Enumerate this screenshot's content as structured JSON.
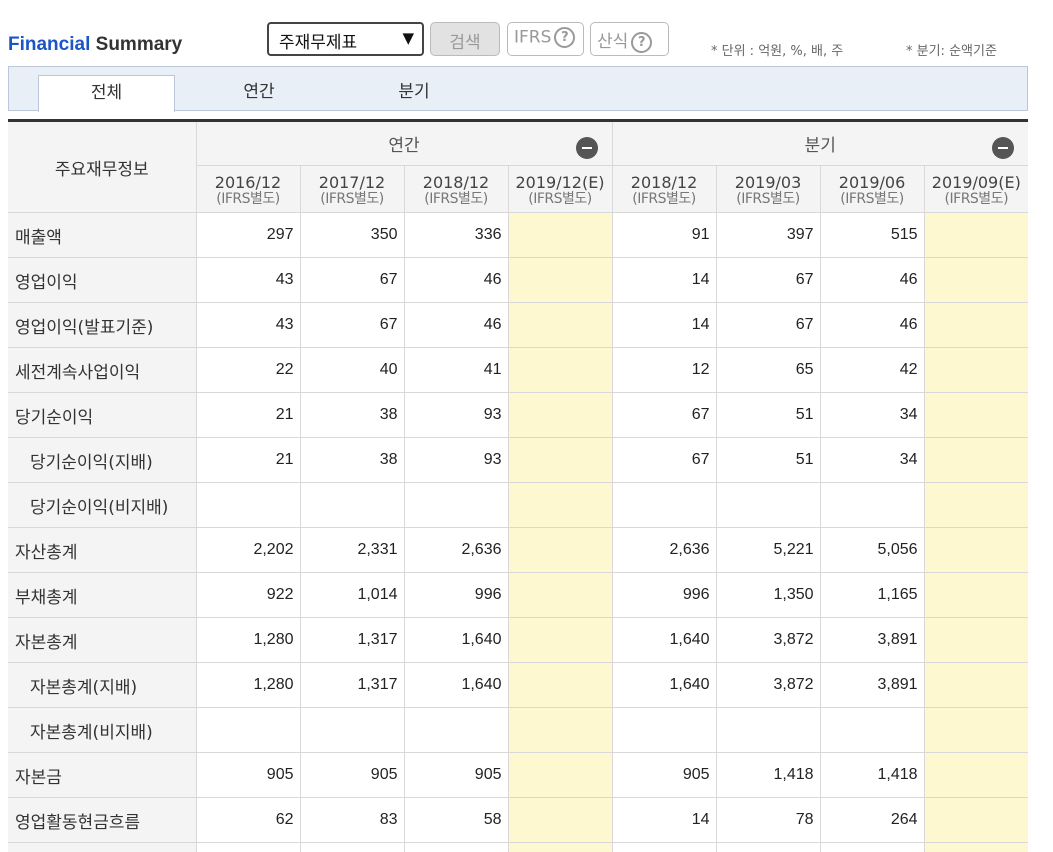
{
  "header": {
    "title_hl": "Financial",
    "title_rest": "Summary",
    "select_value": "주재무제표",
    "select_arrow": "▼",
    "search_label": "검색",
    "ifrs_label": "IFRS",
    "calc_label": "산식",
    "help_glyph": "?",
    "unit_note": "* 단위 : 억원, %, 배, 주",
    "quarter_note": "* 분기: 순액기준"
  },
  "tabs": [
    "전체",
    "연간",
    "분기"
  ],
  "table": {
    "corner_label": "주요재무정보",
    "group_annual": "연간",
    "group_quarter": "분기",
    "periods": [
      {
        "label": "2016/12",
        "sub": "(IFRS별도)",
        "estimate": false
      },
      {
        "label": "2017/12",
        "sub": "(IFRS별도)",
        "estimate": false
      },
      {
        "label": "2018/12",
        "sub": "(IFRS별도)",
        "estimate": false
      },
      {
        "label": "2019/12(E)",
        "sub": "(IFRS별도)",
        "estimate": true
      },
      {
        "label": "2018/12",
        "sub": "(IFRS별도)",
        "estimate": false
      },
      {
        "label": "2019/03",
        "sub": "(IFRS별도)",
        "estimate": false
      },
      {
        "label": "2019/06",
        "sub": "(IFRS별도)",
        "estimate": false
      },
      {
        "label": "2019/09(E)",
        "sub": "(IFRS별도)",
        "estimate": true
      }
    ],
    "rows": [
      {
        "label": "매출액",
        "indent": false,
        "values": [
          "297",
          "350",
          "336",
          "",
          "91",
          "397",
          "515",
          ""
        ]
      },
      {
        "label": "영업이익",
        "indent": false,
        "values": [
          "43",
          "67",
          "46",
          "",
          "14",
          "67",
          "46",
          ""
        ]
      },
      {
        "label": "영업이익(발표기준)",
        "indent": false,
        "values": [
          "43",
          "67",
          "46",
          "",
          "14",
          "67",
          "46",
          ""
        ]
      },
      {
        "label": "세전계속사업이익",
        "indent": false,
        "values": [
          "22",
          "40",
          "41",
          "",
          "12",
          "65",
          "42",
          ""
        ]
      },
      {
        "label": "당기순이익",
        "indent": false,
        "values": [
          "21",
          "38",
          "93",
          "",
          "67",
          "51",
          "34",
          ""
        ]
      },
      {
        "label": "당기순이익(지배)",
        "indent": true,
        "values": [
          "21",
          "38",
          "93",
          "",
          "67",
          "51",
          "34",
          ""
        ]
      },
      {
        "label": "당기순이익(비지배)",
        "indent": true,
        "values": [
          "",
          "",
          "",
          "",
          "",
          "",
          "",
          ""
        ]
      },
      {
        "label": "자산총계",
        "indent": false,
        "values": [
          "2,202",
          "2,331",
          "2,636",
          "",
          "2,636",
          "5,221",
          "5,056",
          ""
        ]
      },
      {
        "label": "부채총계",
        "indent": false,
        "values": [
          "922",
          "1,014",
          "996",
          "",
          "996",
          "1,350",
          "1,165",
          ""
        ]
      },
      {
        "label": "자본총계",
        "indent": false,
        "values": [
          "1,280",
          "1,317",
          "1,640",
          "",
          "1,640",
          "3,872",
          "3,891",
          ""
        ]
      },
      {
        "label": "자본총계(지배)",
        "indent": true,
        "values": [
          "1,280",
          "1,317",
          "1,640",
          "",
          "1,640",
          "3,872",
          "3,891",
          ""
        ]
      },
      {
        "label": "자본총계(비지배)",
        "indent": true,
        "values": [
          "",
          "",
          "",
          "",
          "",
          "",
          "",
          ""
        ]
      },
      {
        "label": "자본금",
        "indent": false,
        "values": [
          "905",
          "905",
          "905",
          "",
          "905",
          "1,418",
          "1,418",
          ""
        ]
      },
      {
        "label": "영업활동현금흐름",
        "indent": false,
        "values": [
          "62",
          "83",
          "58",
          "",
          "14",
          "78",
          "264",
          ""
        ]
      },
      {
        "label": "",
        "indent": false,
        "values": [
          "",
          "",
          "",
          "",
          "",
          "",
          "",
          ""
        ]
      }
    ]
  }
}
